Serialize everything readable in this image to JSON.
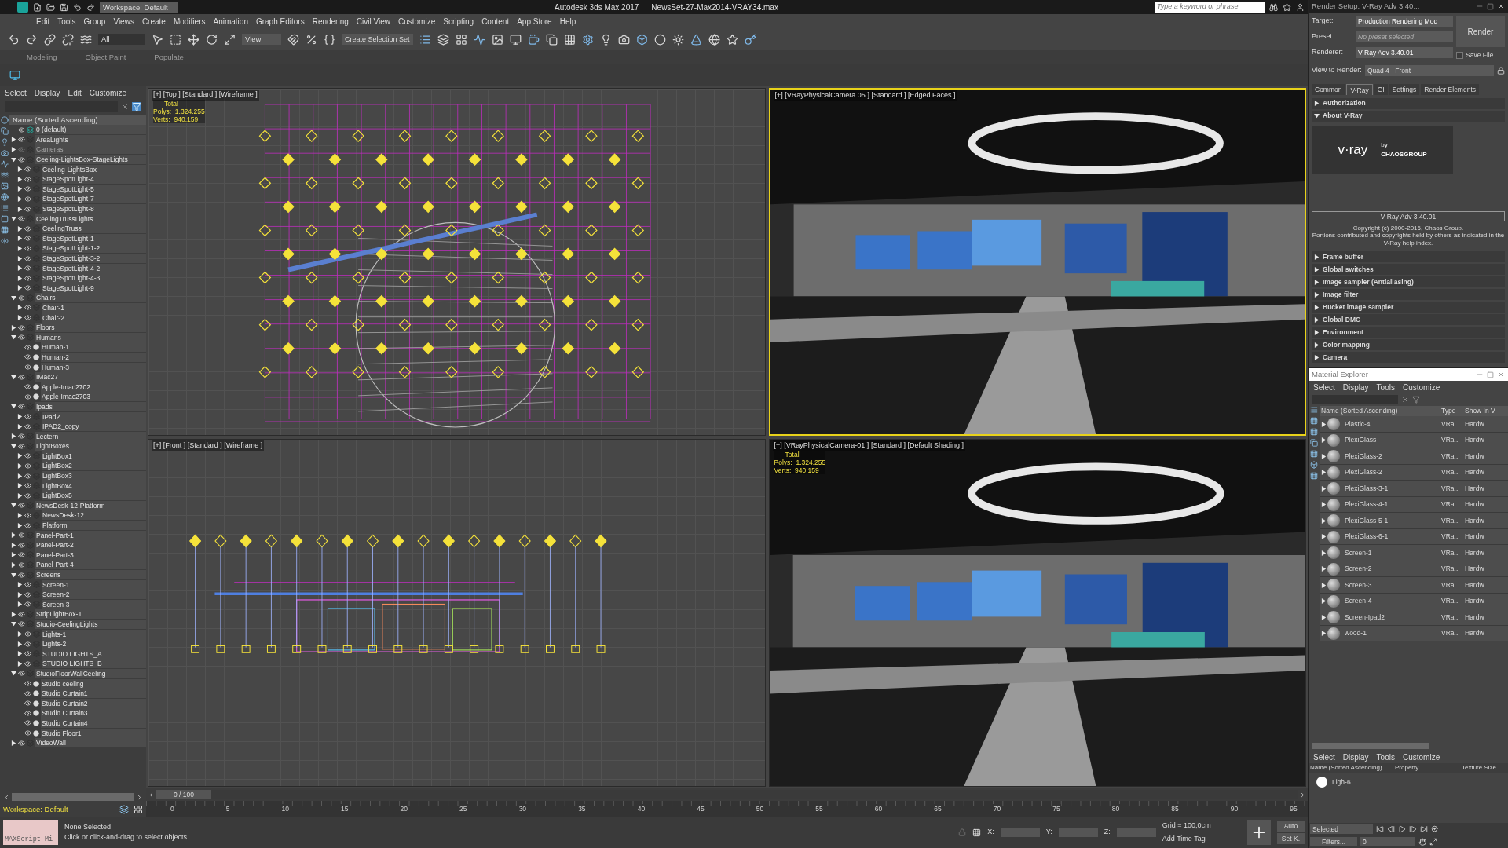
{
  "title_bar": {
    "workspace": "Workspace: Default",
    "title": "Autodesk 3ds Max 2017",
    "file": "NewsSet-27-Max2014-VRAY34.max",
    "search_placeholder": "Type a keyword or phrase"
  },
  "menu": [
    "Edit",
    "Tools",
    "Group",
    "Views",
    "Create",
    "Modifiers",
    "Animation",
    "Graph Editors",
    "Rendering",
    "Civil View",
    "Customize",
    "Scripting",
    "Content",
    "App Store",
    "Help"
  ],
  "toolbar": {
    "filter": "All",
    "view": "View",
    "selection_set": "Create Selection Set"
  },
  "ribbon_tabs": [
    {
      "label": "Modeling",
      "selected": false
    },
    {
      "label": "Object Paint",
      "selected": false
    },
    {
      "label": "Populate",
      "selected": false
    }
  ],
  "scene_explorer": {
    "menu": [
      "Select",
      "Display",
      "Edit",
      "Customize"
    ],
    "header": "Name (Sorted Ascending)",
    "workspace": "Workspace: Default",
    "tree": [
      {
        "name": "0 (default)",
        "kind": "default"
      },
      {
        "name": "AreaLights",
        "kind": "layer",
        "expanded": false
      },
      {
        "name": "Cameras",
        "kind": "layer",
        "expanded": false,
        "hidden": true
      },
      {
        "name": "Ceeling-LightsBox-StageLights",
        "kind": "layer",
        "expanded": true,
        "children": [
          {
            "name": "Ceeling-LightsBox",
            "kind": "layer",
            "expanded": false
          },
          {
            "name": "StageSpotLight-4",
            "kind": "layer",
            "expanded": false
          },
          {
            "name": "StageSpotLight-5",
            "kind": "layer",
            "expanded": false
          },
          {
            "name": "StageSpotLight-7",
            "kind": "layer",
            "expanded": false
          },
          {
            "name": "StageSpotLight-8",
            "kind": "layer",
            "expanded": false
          }
        ]
      },
      {
        "name": "CeelingTrussLights",
        "kind": "layer",
        "expanded": true,
        "children": [
          {
            "name": "CeelingTruss",
            "kind": "layer",
            "expanded": false
          },
          {
            "name": "StageSpotLight-1",
            "kind": "layer",
            "expanded": false
          },
          {
            "name": "StageSpotLight-1-2",
            "kind": "layer",
            "expanded": false
          },
          {
            "name": "StageSpotLight-3-2",
            "kind": "layer",
            "expanded": false
          },
          {
            "name": "StageSpotLight-4-2",
            "kind": "layer",
            "expanded": false
          },
          {
            "name": "StageSpotLight-4-3",
            "kind": "layer",
            "expanded": false
          },
          {
            "name": "StageSpotLight-9",
            "kind": "layer",
            "expanded": false
          }
        ]
      },
      {
        "name": "Chairs",
        "kind": "layer",
        "expanded": true,
        "children": [
          {
            "name": "Chair-1",
            "kind": "layer",
            "expanded": false
          },
          {
            "name": "Chair-2",
            "kind": "layer",
            "expanded": false
          }
        ]
      },
      {
        "name": "Floors",
        "kind": "layer",
        "expanded": false
      },
      {
        "name": "Humans",
        "kind": "layer",
        "expanded": true,
        "children": [
          {
            "name": "Human-1",
            "kind": "object"
          },
          {
            "name": "Human-2",
            "kind": "object"
          },
          {
            "name": "Human-3",
            "kind": "object"
          }
        ]
      },
      {
        "name": "IMac27",
        "kind": "layer",
        "expanded": true,
        "children": [
          {
            "name": "Apple-Imac2702",
            "kind": "object"
          },
          {
            "name": "Apple-Imac2703",
            "kind": "object"
          }
        ]
      },
      {
        "name": "Ipads",
        "kind": "layer",
        "expanded": true,
        "children": [
          {
            "name": "IPad2",
            "kind": "layer",
            "expanded": false
          },
          {
            "name": "IPAD2_copy",
            "kind": "layer",
            "expanded": false
          }
        ]
      },
      {
        "name": "Lectern",
        "kind": "layer",
        "expanded": false
      },
      {
        "name": "LightBoxes",
        "kind": "layer",
        "expanded": true,
        "children": [
          {
            "name": "LightBox1",
            "kind": "layer",
            "expanded": false
          },
          {
            "name": "LightBox2",
            "kind": "layer",
            "expanded": false
          },
          {
            "name": "LightBox3",
            "kind": "layer",
            "expanded": false
          },
          {
            "name": "LightBox4",
            "kind": "layer",
            "expanded": false
          },
          {
            "name": "LightBox5",
            "kind": "layer",
            "expanded": false
          }
        ]
      },
      {
        "name": "NewsDesk-12-Platform",
        "kind": "layer",
        "expanded": true,
        "children": [
          {
            "name": "NewsDesk-12",
            "kind": "layer",
            "expanded": false
          },
          {
            "name": "Platform",
            "kind": "layer",
            "expanded": false
          }
        ]
      },
      {
        "name": "Panel-Part-1",
        "kind": "layer",
        "expanded": false
      },
      {
        "name": "Panel-Part-2",
        "kind": "layer",
        "expanded": false
      },
      {
        "name": "Panel-Part-3",
        "kind": "layer",
        "expanded": false
      },
      {
        "name": "Panel-Part-4",
        "kind": "layer",
        "expanded": false
      },
      {
        "name": "Screens",
        "kind": "layer",
        "expanded": true,
        "children": [
          {
            "name": "Screen-1",
            "kind": "layer",
            "expanded": false
          },
          {
            "name": "Screen-2",
            "kind": "layer",
            "expanded": false
          },
          {
            "name": "Screen-3",
            "kind": "layer",
            "expanded": false
          }
        ]
      },
      {
        "name": "StripLightBox-1",
        "kind": "layer",
        "expanded": false
      },
      {
        "name": "Studio-CeelingLights",
        "kind": "layer",
        "expanded": true,
        "children": [
          {
            "name": "Lights-1",
            "kind": "layer",
            "expanded": false
          },
          {
            "name": "Lights-2",
            "kind": "layer",
            "expanded": false
          },
          {
            "name": "STUDIO LIGHTS_A",
            "kind": "layer",
            "expanded": false
          },
          {
            "name": "STUDIO LIGHTS_B",
            "kind": "layer",
            "expanded": false
          }
        ]
      },
      {
        "name": "StudioFloorWallCeeling",
        "kind": "layer",
        "expanded": true,
        "children": [
          {
            "name": "Studio ceeling",
            "kind": "object"
          },
          {
            "name": "Studio Curtain1",
            "kind": "object"
          },
          {
            "name": "Studio Curtain2",
            "kind": "object"
          },
          {
            "name": "Studio Curtain3",
            "kind": "object"
          },
          {
            "name": "Studio Curtain4",
            "kind": "object"
          },
          {
            "name": "Studio Floor1",
            "kind": "object"
          }
        ]
      },
      {
        "name": "VideoWall",
        "kind": "layer",
        "expanded": false
      }
    ]
  },
  "viewports": [
    {
      "label": "[+] [Top ] [Standard ] [Wireframe ]",
      "kind": "top",
      "active": false,
      "stats": [
        "Total",
        "Polys:  1.324.255",
        "Verts:  940.159"
      ]
    },
    {
      "label": "[+] [VRayPhysicalCamera 05 ] [Standard ] [Edged Faces ]",
      "kind": "camera",
      "active": true
    },
    {
      "label": "[+] [Front ] [Standard ] [Wireframe ]",
      "kind": "front",
      "active": false
    },
    {
      "label": "[+] [VRayPhysicalCamera-01 ] [Standard ] [Default Shading ]",
      "kind": "camera",
      "active": false,
      "stats": [
        "Total",
        "Polys:  1.324.255",
        "Verts:  940.159"
      ]
    }
  ],
  "timeline": {
    "frame": "0 / 100",
    "level": 0,
    "ticks": [
      "0",
      "5",
      "10",
      "15",
      "20",
      "25",
      "30",
      "35",
      "40",
      "45",
      "50",
      "55",
      "60",
      "65",
      "70",
      "75",
      "80",
      "85",
      "90",
      "95"
    ]
  },
  "status_bar": {
    "maxscript": "MAXScript Mi",
    "selection": "None Selected",
    "prompt": "Click or click-and-drag to select objects",
    "x": "X:",
    "y": "Y:",
    "z": "Z:",
    "grid": "Grid = 100,0cm",
    "time_tag": "Add Time Tag",
    "auto": "Auto",
    "set_key": "Set K."
  },
  "render_setup": {
    "title": "Render Setup: V-Ray Adv 3.40...",
    "fields": [
      {
        "label": "Target:",
        "value": "Production Rendering Moc",
        "disabled": false
      },
      {
        "label": "Preset:",
        "value": "No preset selected",
        "disabled": true
      },
      {
        "label": "Renderer:",
        "value": "V-Ray Adv 3.40.01",
        "disabled": false
      }
    ],
    "render_button": "Render",
    "save_file": {
      "label": "Save File",
      "checked": false
    },
    "view_label": "View to Render:",
    "view_value": "Quad 4 - Front",
    "tabs": [
      {
        "label": "Common",
        "selected": false
      },
      {
        "label": "V-Ray",
        "selected": true
      },
      {
        "label": "GI",
        "selected": false
      },
      {
        "label": "Settings",
        "selected": false
      },
      {
        "label": "Render Elements",
        "selected": false
      }
    ],
    "rollouts": [
      {
        "label": "Authorization",
        "expanded": false
      },
      {
        "label": "About V-Ray",
        "expanded": true
      },
      {
        "label": "Frame buffer",
        "expanded": false
      },
      {
        "label": "Global switches",
        "expanded": false
      },
      {
        "label": "Image sampler (Antialiasing)",
        "expanded": false
      },
      {
        "label": "Image filter",
        "expanded": false
      },
      {
        "label": "Bucket image sampler",
        "expanded": false
      },
      {
        "label": "Global DMC",
        "expanded": false
      },
      {
        "label": "Environment",
        "expanded": false
      },
      {
        "label": "Color mapping",
        "expanded": false
      },
      {
        "label": "Camera",
        "expanded": false
      }
    ],
    "logo": {
      "name": "v·ray",
      "by": "by",
      "company": "CHAOSGROUP"
    },
    "version": "V-Ray Adv 3.40.01",
    "copyright": "Copyright (c) 2000-2016, Chaos Group.\nPortions contributed and copyrights held by others as indicated in the V-Ray help index."
  },
  "material_explorer": {
    "title": "Material Explorer",
    "menu": [
      "Select",
      "Display",
      "Tools",
      "Customize"
    ],
    "columns": [
      "Name (Sorted Ascending)",
      "Type",
      "Show In V"
    ],
    "rows": [
      {
        "name": "Plastic-4",
        "type": "VRa...",
        "show": "Hardw"
      },
      {
        "name": "PlexiGlass",
        "type": "VRa...",
        "show": "Hardw"
      },
      {
        "name": "PlexiGlass-2",
        "type": "VRa...",
        "show": "Hardw"
      },
      {
        "name": "PlexiGlass-2",
        "type": "VRa...",
        "show": "Hardw"
      },
      {
        "name": "PlexiGlass-3-1",
        "type": "VRa...",
        "show": "Hardw"
      },
      {
        "name": "PlexiGlass-4-1",
        "type": "VRa...",
        "show": "Hardw"
      },
      {
        "name": "PlexiGlass-5-1",
        "type": "VRa...",
        "show": "Hardw"
      },
      {
        "name": "PlexiGlass-6-1",
        "type": "VRa...",
        "show": "Hardw"
      },
      {
        "name": "Screen-1",
        "type": "VRa...",
        "show": "Hardw"
      },
      {
        "name": "Screen-2",
        "type": "VRa...",
        "show": "Hardw"
      },
      {
        "name": "Screen-3",
        "type": "VRa...",
        "show": "Hardw"
      },
      {
        "name": "Screen-4",
        "type": "VRa...",
        "show": "Hardw"
      },
      {
        "name": "Screen-Ipad2",
        "type": "VRa...",
        "show": "Hardw"
      },
      {
        "name": "wood-1",
        "type": "VRa...",
        "show": "Hardw"
      }
    ],
    "lower_menu": [
      "Select",
      "Display",
      "Tools",
      "Customize"
    ],
    "lower_columns": [
      "Name (Sorted Ascending)",
      "Property",
      "Texture Size"
    ],
    "lower_rows": [
      {
        "name": "Ligh-6"
      }
    ]
  },
  "playback": {
    "selection": "Selected",
    "filters": "Filters...",
    "frame": "0"
  }
}
